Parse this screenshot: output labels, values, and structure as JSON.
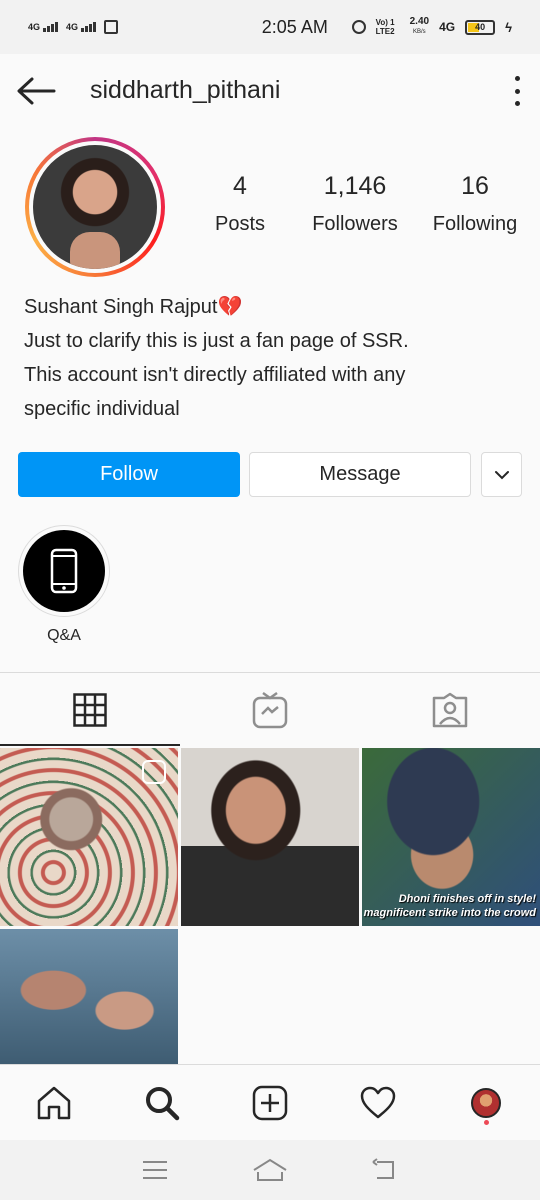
{
  "status_bar": {
    "network1": "4G",
    "network2": "4G",
    "time": "2:05 AM",
    "volte": "Vo) 1 LTE2",
    "speed": "2.40",
    "speed_unit": "KB/s",
    "network3": "4G",
    "battery": "40"
  },
  "header": {
    "username": "siddharth_pithani"
  },
  "profile": {
    "stats": [
      {
        "value": "4",
        "label": "Posts"
      },
      {
        "value": "1,146",
        "label": "Followers"
      },
      {
        "value": "16",
        "label": "Following"
      }
    ],
    "bio": {
      "name": "Sushant Singh Rajput",
      "name_emoji": "💔",
      "lines": [
        "Just to clarify this is just a fan page of SSR.",
        "This account isn't directly affiliated with any",
        "specific individual"
      ]
    }
  },
  "actions": {
    "follow_label": "Follow",
    "message_label": "Message"
  },
  "highlights": [
    {
      "label": "Q&A",
      "icon": "phone-icon"
    }
  ],
  "tabs": [
    {
      "icon": "grid-icon",
      "active": true
    },
    {
      "icon": "igtv-icon",
      "active": false
    },
    {
      "icon": "tagged-icon",
      "active": false
    }
  ],
  "posts": [
    {
      "caption": ""
    },
    {
      "caption": ""
    },
    {
      "caption": "Dhoni finishes off in style!\nmagnificent strike into the crowd"
    },
    {
      "caption": ""
    }
  ],
  "colors": {
    "follow_blue": "#0095f6",
    "text": "#262626",
    "border": "#dbdbdb",
    "notification_dot": "#ed4956"
  }
}
